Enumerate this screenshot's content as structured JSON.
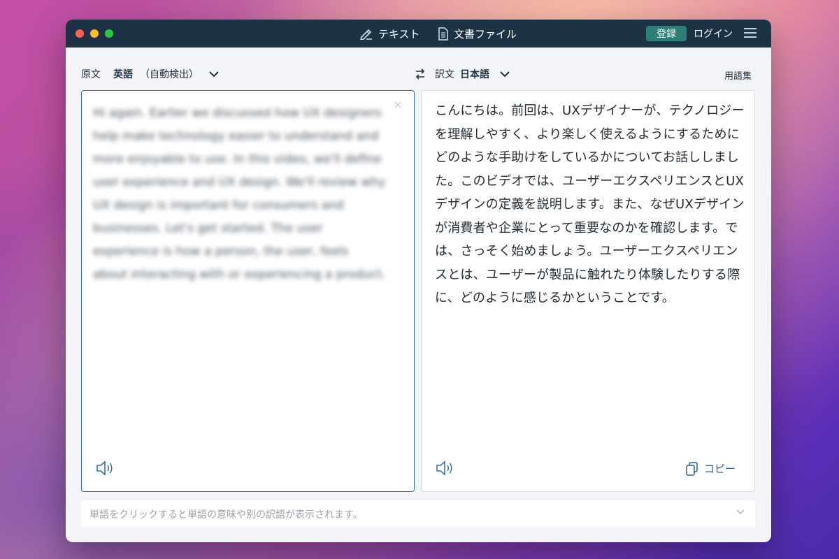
{
  "titlebar": {
    "tabs": [
      {
        "label": "テキスト",
        "icon": "pencil-icon"
      },
      {
        "label": "文書ファイル",
        "icon": "document-icon"
      }
    ],
    "signup_label": "登録",
    "login_label": "ログイン"
  },
  "source": {
    "label": "原文",
    "language": "英語",
    "detect": "（自動検出）",
    "text": "Hi again. Earlier we discussed how UX designers help make technology easier to understand and more enjoyable to use. In this video, we'll define user experience and UX design. We'll review why UX design is important for consumers and businesses. Let's get started. The user experience is how a person, the user, feels about interacting with or experiencing a product."
  },
  "target": {
    "label": "訳文",
    "language": "日本語",
    "text": "こんにちは。前回は、UXデザイナーが、テクノロジーを理解しやすく、より楽しく使えるようにするためにどのような手助けをしているかについてお話ししました。このビデオでは、ユーザーエクスペリエンスとUXデザインの定義を説明します。また、なぜUXデザインが消費者や企業にとって重要なのかを確認します。では、さっそく始めましょう。ユーザーエクスペリエンスとは、ユーザーが製品に触れたり体験したりする際に、どのように感じるかということです。",
    "copy_label": "コピー"
  },
  "glossary_label": "用語集",
  "hint": "単語をクリックすると単語の意味や別の訳語が表示されます。",
  "colors": {
    "titlebar": "#1e3246",
    "accent_button": "#2d7f78",
    "active_border": "#3a6d9e"
  }
}
